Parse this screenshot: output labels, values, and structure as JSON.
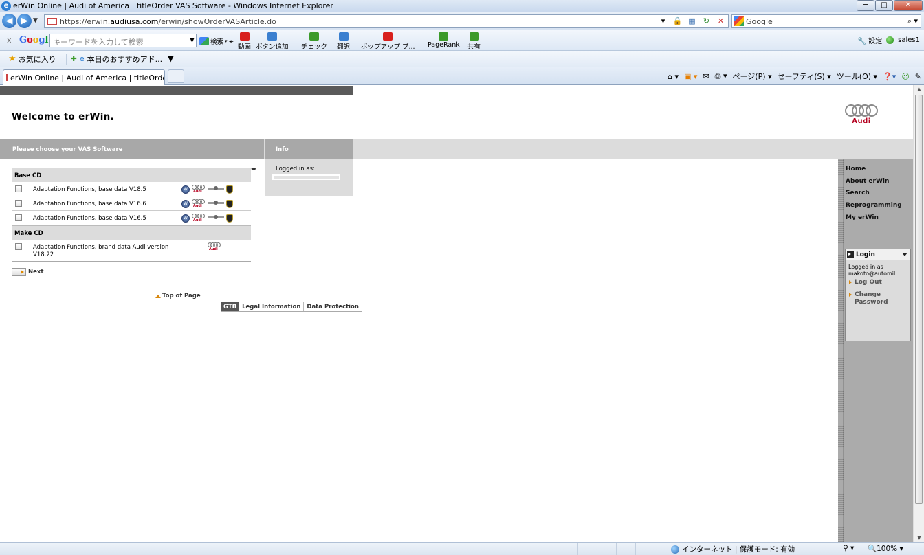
{
  "browser": {
    "window_title": "erWin Online | Audi of America | titleOrder VAS Software - Windows Internet Explorer",
    "url_prefix": "https://erwin.",
    "url_domain": "audiusa.com",
    "url_path": "/erwin/showOrderVASArticle.do",
    "search_provider": "Google",
    "search_arrow": "⌕ ▾",
    "tab_title": "erWin Online | Audi of America | titleOrder ...",
    "window_buttons": {
      "minimize": "─",
      "maximize": "□",
      "close": "✕"
    }
  },
  "google_toolbar": {
    "close": "x",
    "logo": [
      "G",
      "o",
      "o",
      "g",
      "l",
      "e"
    ],
    "search_placeholder": "キーワードを入力して検索",
    "search_button": "検索",
    "buttons": [
      {
        "label": "動画",
        "icon": "youtube-icon",
        "color": "#d8201d"
      },
      {
        "label": "ボタン追加",
        "icon": "add-button-icon",
        "color": "#3a7fd0"
      },
      {
        "label": "チェック",
        "icon": "spellcheck-icon",
        "color": "#3c9a2a"
      },
      {
        "label": "翻訳",
        "icon": "translate-icon",
        "color": "#3a7fd0"
      },
      {
        "label": "ポップアップ ブ...",
        "icon": "popup-blocker-icon",
        "color": "#d8201d"
      },
      {
        "label": "PageRank",
        "icon": "pagerank-icon",
        "color": "#3c9a2a"
      },
      {
        "label": "共有",
        "icon": "share-icon",
        "color": "#3c9a2a"
      }
    ],
    "settings_label": "設定",
    "user_label": "sales1"
  },
  "favorites_bar": {
    "favorites": "お気に入り",
    "recommended": "本日のおすすめアド..."
  },
  "command_bar": {
    "page": "ページ(P)",
    "safety": "セーフティ(S)",
    "tools": "ツール(O)"
  },
  "page": {
    "welcome": "Welcome to erWin.",
    "brand_word": "Audi",
    "choose_header": "Please choose your VAS Software",
    "info_header": "Info",
    "info_logged_in": "Logged in as:",
    "sections": [
      {
        "title": "Base CD",
        "rows": [
          {
            "label": "Adaptation Functions, base data V18.5",
            "brands": [
              "vw",
              "audi",
              "bentley",
              "lamborghini"
            ]
          },
          {
            "label": "Adaptation Functions, base data V16.6",
            "brands": [
              "vw",
              "audi",
              "bentley",
              "lamborghini"
            ]
          },
          {
            "label": "Adaptation Functions, base data V16.5",
            "brands": [
              "vw",
              "audi",
              "bentley",
              "lamborghini"
            ]
          }
        ]
      },
      {
        "title": "Make CD",
        "rows": [
          {
            "label": "Adaptation Functions, brand data Audi version V18.22",
            "brands": [
              "audi"
            ]
          }
        ]
      }
    ],
    "next": "Next",
    "top_of_page": "Top of Page",
    "footer": {
      "gtb": "GTB",
      "legal": "Legal Information",
      "privacy": "Data Protection"
    }
  },
  "sidebar": {
    "nav": [
      "Home",
      "About erWin",
      "Search",
      "Reprogramming",
      "My erWin"
    ],
    "login": {
      "title": "Login",
      "logged_in_as": "Logged in as",
      "user": "makoto@automil...",
      "logout": "Log Out",
      "change_password": "Change Password"
    }
  },
  "statusbar": {
    "zone": "インターネット | 保護モード: 有効",
    "zoom": "100%"
  }
}
